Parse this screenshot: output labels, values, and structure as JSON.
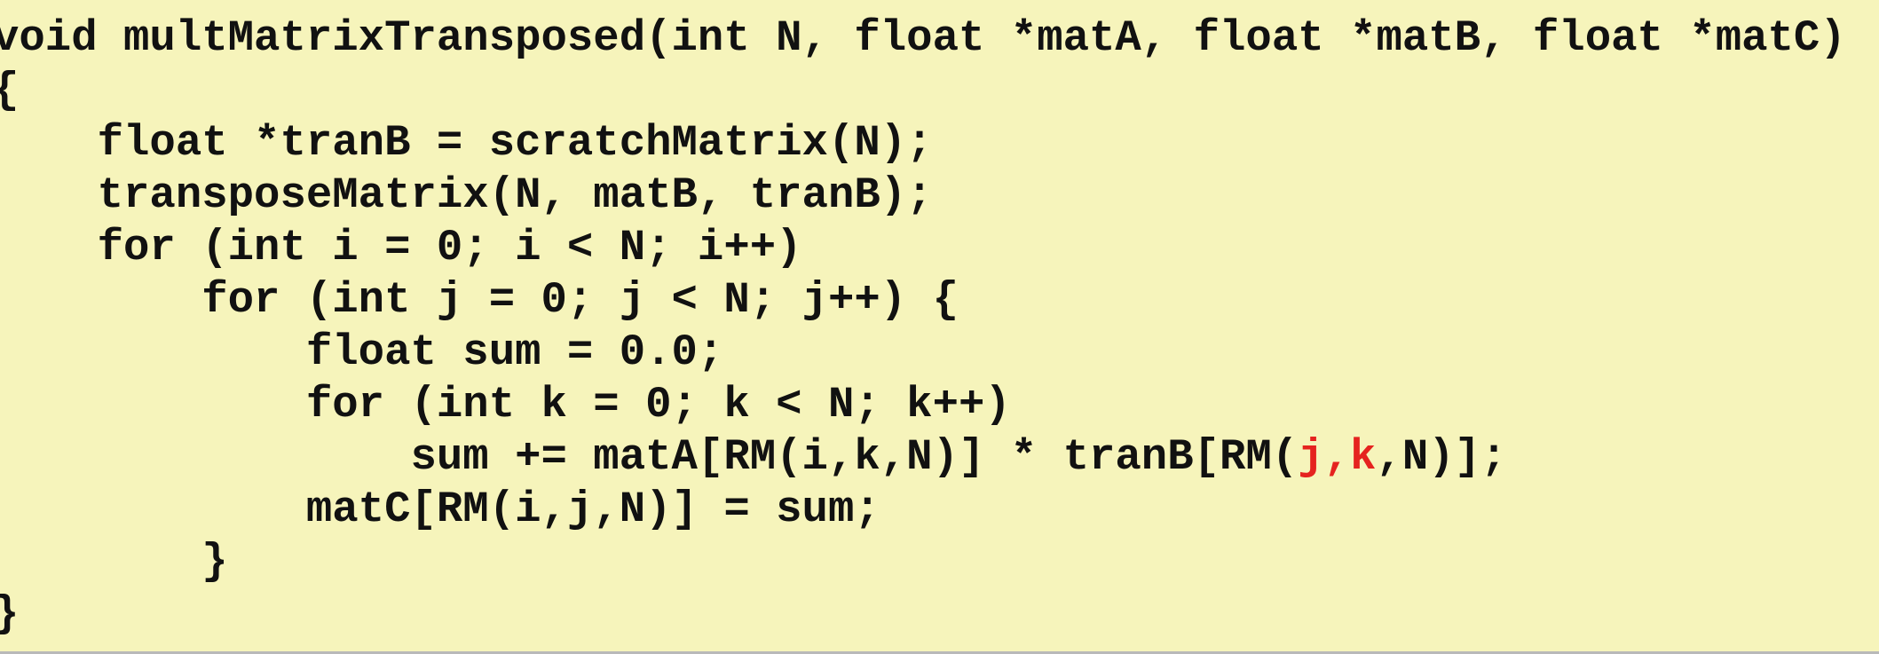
{
  "code": {
    "lines": [
      "void multMatrixTransposed(int N, float *matA, float *matB, float *matC)",
      "{",
      "    float *tranB = scratchMatrix(N);",
      "    transposeMatrix(N, matB, tranB);",
      "    for (int i = 0; i < N; i++)",
      "        for (int j = 0; j < N; j++) {",
      "            float sum = 0.0;",
      "            for (int k = 0; k < N; k++)",
      "            matC[RM(i,j,N)] = sum;",
      "        }",
      "}"
    ],
    "line_sum": {
      "prefix": "                sum += matA[RM(i,k,N)] * tranB[RM(",
      "highlight": "j,k",
      "suffix": ",N)];"
    }
  },
  "colors": {
    "background": "#f6f4bb",
    "text": "#111111",
    "highlight": "#e5231f"
  }
}
